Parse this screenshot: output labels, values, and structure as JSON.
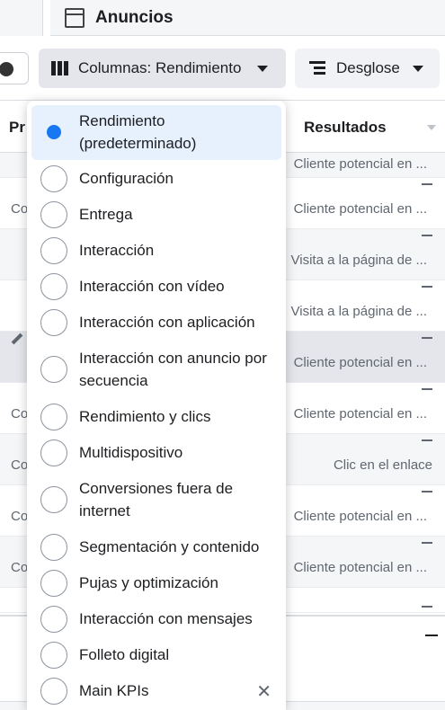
{
  "header": {
    "tab_title": "Anuncios"
  },
  "toolbar": {
    "columns_label": "Columnas: Rendimiento",
    "breakdown_label": "Desglose"
  },
  "table": {
    "col_left_header": "Pr",
    "col_results_header": "Resultados",
    "rows": [
      {
        "left": "",
        "result": "Cliente potencial en ..."
      },
      {
        "left": "Co",
        "result": "Cliente potencial en ..."
      },
      {
        "left": "",
        "result": "Visita a la página de ..."
      },
      {
        "left": "",
        "result": "Visita a la página de ..."
      },
      {
        "left": "",
        "result": "Cliente potencial en ..."
      },
      {
        "left": "Co",
        "result": "Cliente potencial en ..."
      },
      {
        "left": "Co",
        "result": "Clic en el enlace"
      },
      {
        "left": "Co",
        "result": "Cliente potencial en ..."
      },
      {
        "left": "Co",
        "result": "Cliente potencial en ..."
      }
    ]
  },
  "columns_menu": {
    "options": [
      {
        "label": "Rendimiento (predeterminado)",
        "selected": true
      },
      {
        "label": "Configuración",
        "selected": false
      },
      {
        "label": "Entrega",
        "selected": false
      },
      {
        "label": "Interacción",
        "selected": false
      },
      {
        "label": "Interacción con vídeo",
        "selected": false
      },
      {
        "label": "Interacción con aplicación",
        "selected": false
      },
      {
        "label": "Interacción con anuncio por secuencia",
        "selected": false
      },
      {
        "label": "Rendimiento y clics",
        "selected": false
      },
      {
        "label": "Multidispositivo",
        "selected": false
      },
      {
        "label": "Conversiones fuera de internet",
        "selected": false
      },
      {
        "label": "Segmentación y contenido",
        "selected": false
      },
      {
        "label": "Pujas y optimización",
        "selected": false
      },
      {
        "label": "Interacción con mensajes",
        "selected": false
      },
      {
        "label": "Folleto digital",
        "selected": false
      },
      {
        "label": "Main KPIs",
        "selected": false,
        "removable": true
      }
    ]
  },
  "colors": {
    "accent": "#1877f2",
    "selected_bg": "#e7f0fd"
  }
}
